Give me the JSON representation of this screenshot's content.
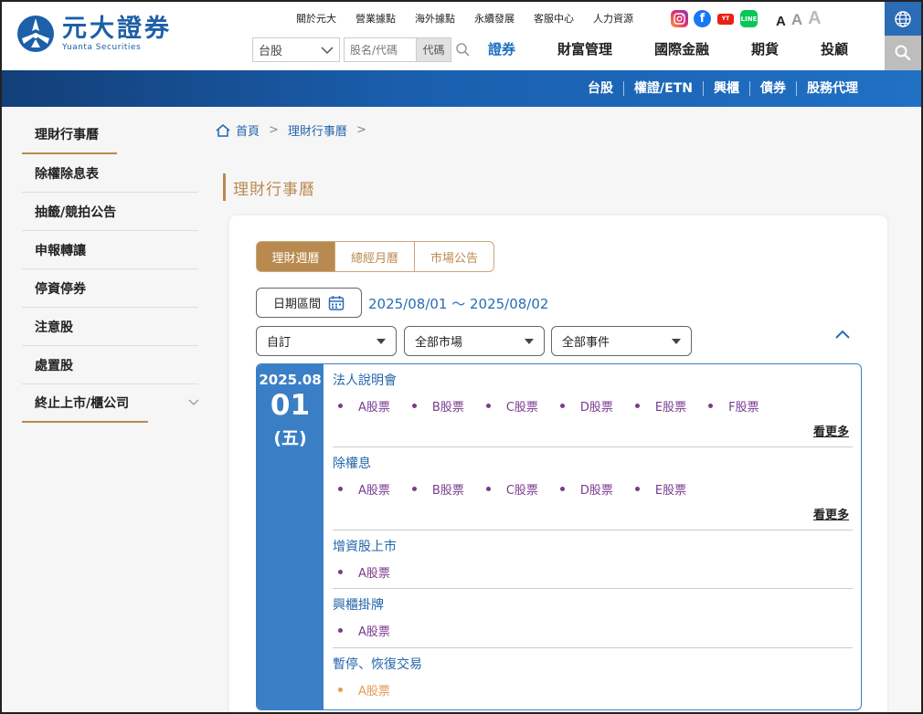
{
  "brand": {
    "name_cn": "元大證券",
    "name_en": "Yuanta Securities"
  },
  "toplinks": [
    "關於元大",
    "營業據點",
    "海外據點",
    "永續發展",
    "客服中心",
    "人力資源"
  ],
  "social": [
    "instagram-icon",
    "facebook-icon",
    "youtube-icon",
    "line-icon"
  ],
  "font_sizes": [
    "A",
    "A",
    "A"
  ],
  "search": {
    "market": "台股",
    "placeholder": "股名/代碼",
    "code_label": "代碼"
  },
  "mainnav": [
    {
      "label": "證券",
      "active": true
    },
    {
      "label": "財富管理",
      "active": false
    },
    {
      "label": "國際金融",
      "active": false
    },
    {
      "label": "期貨",
      "active": false
    },
    {
      "label": "投顧",
      "active": false
    }
  ],
  "subnav": [
    "台股",
    "權證/ETN",
    "興櫃",
    "債券",
    "股務代理"
  ],
  "sidebar": [
    "理財行事曆",
    "除權除息表",
    "抽籤/競拍公告",
    "申報轉讓",
    "停資停券",
    "注意股",
    "處置股",
    "終止上市/櫃公司"
  ],
  "breadcrumb": {
    "home": "首頁",
    "current": "理財行事曆",
    "sep": ">"
  },
  "page_title": "理財行事曆",
  "tabs": [
    "理財週曆",
    "總經月曆",
    "市場公告"
  ],
  "date_button": "日期區間",
  "date_range": "2025/08/01 ～ 2025/08/02",
  "filters": [
    "自訂",
    "全部市場",
    "全部事件"
  ],
  "calendar": {
    "year_month": "2025.08",
    "day": "01",
    "weekday": "(五)",
    "more_label": "看更多",
    "events": [
      {
        "title": "法人說明會",
        "items": [
          "A股票",
          "B股票",
          "C股票",
          "D股票",
          "E股票",
          "F股票"
        ],
        "more": true,
        "color": "#7a3a8e"
      },
      {
        "title": "除權息",
        "items": [
          "A股票",
          "B股票",
          "C股票",
          "D股票",
          "E股票"
        ],
        "more": true,
        "color": "#7a3a8e"
      },
      {
        "title": "增資股上市",
        "items": [
          "A股票"
        ],
        "more": false,
        "color": "#7a3a8e"
      },
      {
        "title": "興櫃掛牌",
        "items": [
          "A股票"
        ],
        "more": false,
        "color": "#7a3a8e"
      },
      {
        "title": "暫停、恢復交易",
        "items": [
          "A股票"
        ],
        "more": false,
        "color": "#e39a52"
      }
    ]
  },
  "colors": {
    "brand_blue": "#1d5fa8",
    "gold": "#b98a4f",
    "link_blue": "#2466ac",
    "calendar_blue": "#3a7fc6",
    "item_purple": "#7a3a8e",
    "item_orange": "#e39a52"
  }
}
